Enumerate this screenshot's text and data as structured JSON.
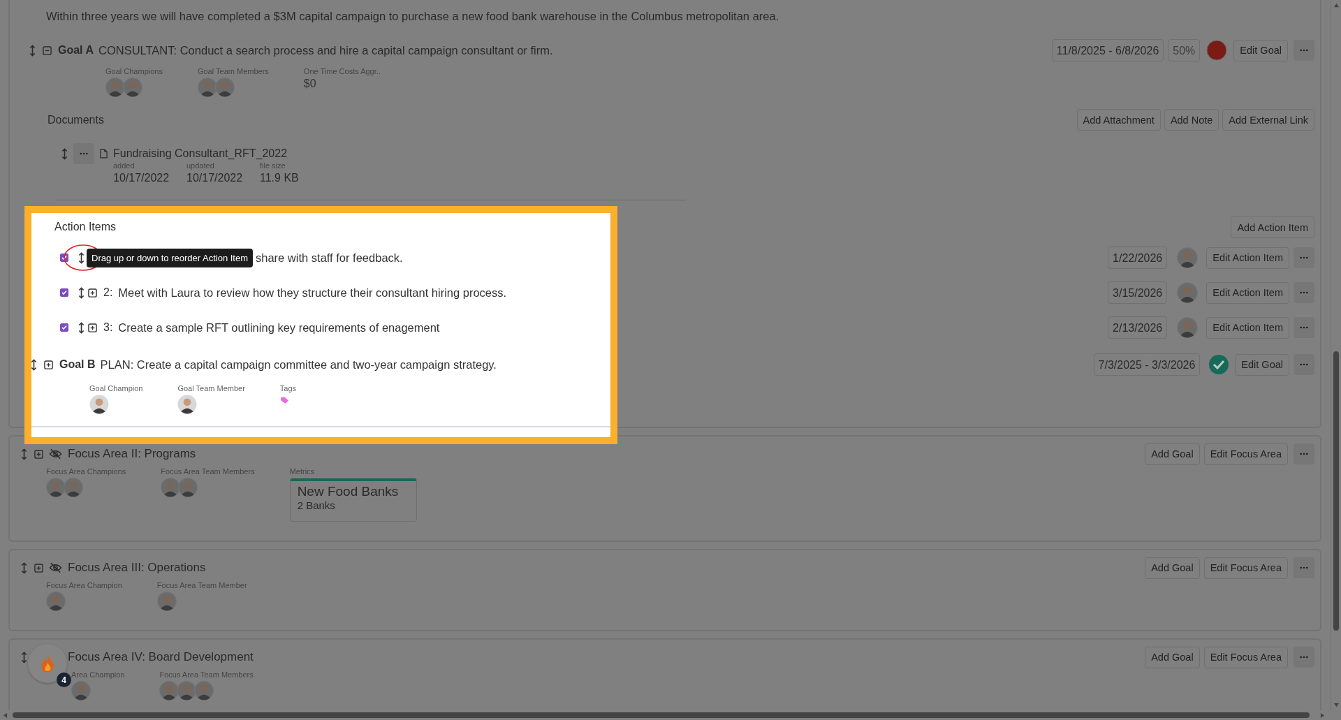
{
  "vision": {
    "text": "Within three years we will have completed a $3M capital campaign to purchase a new food bank warehouse in the Columbus metropolitan area."
  },
  "goals": [
    {
      "label": "Goal A",
      "title": "CONSULTANT: Conduct a search process and hire a capital campaign consultant or firm.",
      "expanded": true,
      "date_range": "11/8/2025 - 6/8/2026",
      "percent": "50%",
      "complete": false,
      "edit_button": "Edit Goal",
      "meta": [
        {
          "kind": "people",
          "label": "Goal Champions",
          "people": [
            {
              "kind": "photo"
            },
            {
              "kind": "photo"
            }
          ]
        },
        {
          "kind": "people",
          "label": "Goal Team Members",
          "people": [
            {
              "kind": "photo"
            },
            {
              "kind": "photo"
            }
          ]
        },
        {
          "kind": "value",
          "label": "One Time Costs Aggr..",
          "value": "$0"
        }
      ],
      "documents": {
        "title": "Documents",
        "buttons": [
          "Add Attachment",
          "Add Note",
          "Add External Link"
        ],
        "files": [
          {
            "name": "Fundraising Consultant_RFT_2022",
            "fields": [
              {
                "label": "added",
                "value": "10/17/2022"
              },
              {
                "label": "updated",
                "value": "10/17/2022"
              },
              {
                "label": "file size",
                "value": "11.9 KB"
              }
            ]
          }
        ]
      },
      "action_items": {
        "title": "Action Items",
        "add_button": "Add Action Item",
        "items": [
          {
            "checked": true,
            "text": "share with staff for feedback.",
            "tooltip": "Drag up or down to reorder Action Item",
            "due": "1/22/2026",
            "edit_button": "Edit Action Item"
          },
          {
            "checked": true,
            "expanded": false,
            "number": "2:",
            "text": "Meet with Laura to review how they structure their consultant hiring process.",
            "due": "3/15/2026",
            "edit_button": "Edit Action Item"
          },
          {
            "checked": true,
            "expanded": false,
            "number": "3:",
            "text": "Create a sample RFT outlining key requirements of enagement",
            "due": "2/13/2026",
            "edit_button": "Edit Action Item"
          }
        ]
      }
    },
    {
      "label": "Goal B",
      "title": "PLAN: Create a capital campaign committee and two-year campaign strategy.",
      "expanded": false,
      "date_range": "7/3/2025 - 3/3/2026",
      "complete": true,
      "edit_button": "Edit Goal",
      "meta": [
        {
          "kind": "people",
          "label": "Goal Champion",
          "people": [
            {
              "kind": "photo"
            }
          ]
        },
        {
          "kind": "people",
          "label": "Goal Team Member",
          "people": [
            {
              "kind": "photo"
            }
          ]
        },
        {
          "kind": "tags",
          "label": "Tags",
          "tags": [
            {
              "color": "#e86ae6"
            }
          ]
        }
      ]
    }
  ],
  "focus_areas": [
    {
      "title": "Focus Area II: Programs",
      "expanded": false,
      "hidden": true,
      "buttons": [
        "Add Goal",
        "Edit Focus Area"
      ],
      "meta": [
        {
          "kind": "people",
          "label": "Focus Area Champions",
          "people": [
            {
              "kind": "photo"
            },
            {
              "kind": "photo"
            }
          ]
        },
        {
          "kind": "people",
          "label": "Focus Area Team Members",
          "people": [
            {
              "kind": "photo"
            },
            {
              "kind": "photo"
            }
          ]
        },
        {
          "kind": "metric",
          "label": "Metrics",
          "title": "New Food Banks",
          "value": "2 Banks"
        }
      ]
    },
    {
      "title": "Focus Area III: Operations",
      "expanded": false,
      "hidden": true,
      "buttons": [
        "Add Goal",
        "Edit Focus Area"
      ],
      "meta": [
        {
          "kind": "people",
          "label": "Focus Area Champion",
          "people": [
            {
              "kind": "photo"
            }
          ]
        },
        {
          "kind": "people",
          "label": "Focus Area Team Member",
          "people": [
            {
              "kind": "photo"
            }
          ]
        }
      ]
    },
    {
      "title": "Focus Area IV: Board Development",
      "buttons": [
        "Add Goal",
        "Edit Focus Area"
      ],
      "meta": [
        {
          "kind": "people",
          "label": "Area Champion",
          "people": [
            {
              "kind": "photo"
            }
          ]
        },
        {
          "kind": "people",
          "label": "Focus Area Team Members",
          "people": [
            {
              "kind": "photo"
            },
            {
              "kind": "photo"
            },
            {
              "kind": "photo"
            }
          ]
        }
      ]
    }
  ],
  "help_widget": {
    "badge": "4"
  }
}
